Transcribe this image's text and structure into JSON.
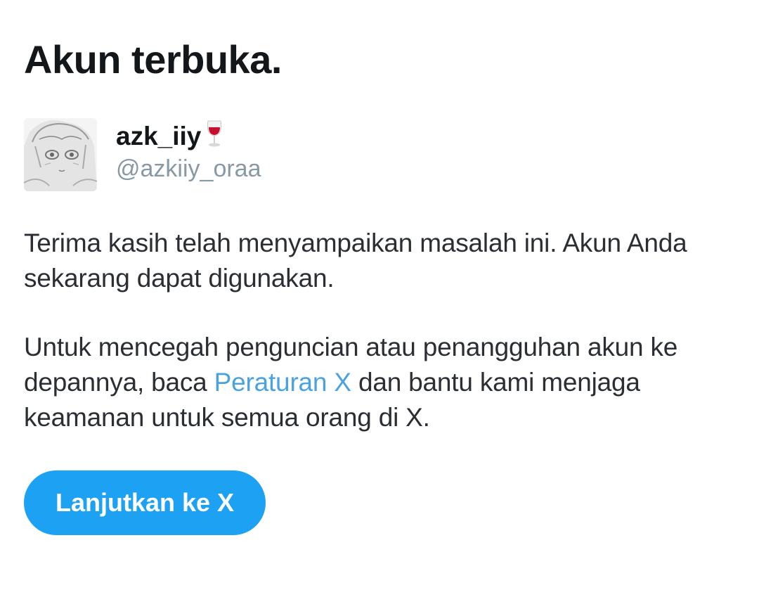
{
  "page": {
    "title": "Akun terbuka."
  },
  "account": {
    "display_name": "azk_iiy",
    "emoji_icon": "wine-glass-icon",
    "handle": "@azkiiy_oraa"
  },
  "message": {
    "paragraph1": "Terima kasih telah menyampaikan masalah ini. Akun Anda sekarang dapat digunakan.",
    "paragraph2_before": "Untuk mencegah penguncian atau penangguhan akun ke depannya, baca ",
    "rules_link": "Peraturan X",
    "paragraph2_after": " dan bantu kami menjaga keamanan untuk semua orang di X."
  },
  "actions": {
    "continue_label": "Lanjutkan ke X"
  },
  "colors": {
    "accent": "#1da1f2",
    "link": "#4aa3df",
    "handle": "#8899a6",
    "text": "#14171a"
  }
}
